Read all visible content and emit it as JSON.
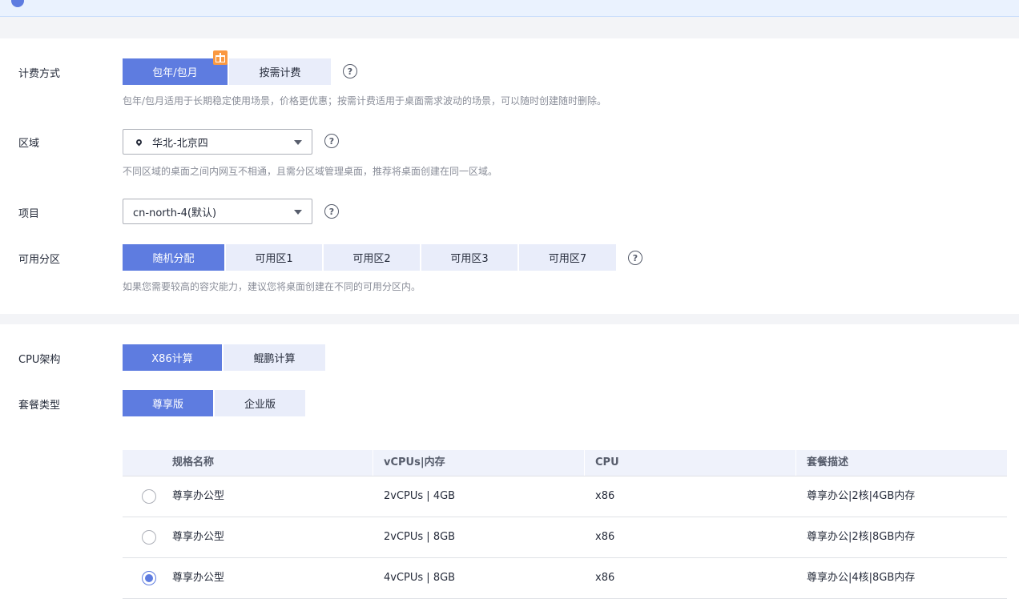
{
  "notice": {
    "text": ""
  },
  "billing": {
    "label": "计费方式",
    "options": [
      "包年/包月",
      "按需计费"
    ],
    "selected": "包年/包月",
    "hint": "包年/包月适用于长期稳定使用场景，价格更优惠；按需计费适用于桌面需求波动的场景，可以随时创建随时删除。"
  },
  "region": {
    "label": "区域",
    "value": "华北-北京四",
    "hint": "不同区域的桌面之间内网互不相通，且需分区域管理桌面，推荐将桌面创建在同一区域。"
  },
  "project": {
    "label": "项目",
    "value": "cn-north-4(默认)"
  },
  "az": {
    "label": "可用分区",
    "options": [
      "随机分配",
      "可用区1",
      "可用区2",
      "可用区3",
      "可用区7"
    ],
    "selected": "随机分配",
    "hint": "如果您需要较高的容灾能力，建议您将桌面创建在不同的可用分区内。"
  },
  "cpu_arch": {
    "label": "CPU架构",
    "options": [
      "X86计算",
      "鲲鹏计算"
    ],
    "selected": "X86计算"
  },
  "package_type": {
    "label": "套餐类型",
    "options": [
      "尊享版",
      "企业版"
    ],
    "selected": "尊享版"
  },
  "spec_table": {
    "headers": [
      "规格名称",
      "vCPUs|内存",
      "CPU",
      "套餐描述"
    ],
    "rows": [
      {
        "name": "尊享办公型",
        "vcpu_mem": "2vCPUs | 4GB",
        "cpu": "x86",
        "desc": "尊享办公|2核|4GB内存",
        "selected": false
      },
      {
        "name": "尊享办公型",
        "vcpu_mem": "2vCPUs | 8GB",
        "cpu": "x86",
        "desc": "尊享办公|2核|8GB内存",
        "selected": false
      },
      {
        "name": "尊享办公型",
        "vcpu_mem": "4vCPUs | 8GB",
        "cpu": "x86",
        "desc": "尊享办公|4核|8GB内存",
        "selected": true
      }
    ]
  },
  "colors": {
    "accent": "#5e7ce0",
    "segment_bg": "#e9edfa",
    "gift": "#fa9841",
    "band": "#f3f4f7"
  },
  "icons": {
    "help": "question-circle-icon",
    "region": "location-pin-icon",
    "dropdown": "chevron-down-icon",
    "promo": "gift-icon"
  }
}
